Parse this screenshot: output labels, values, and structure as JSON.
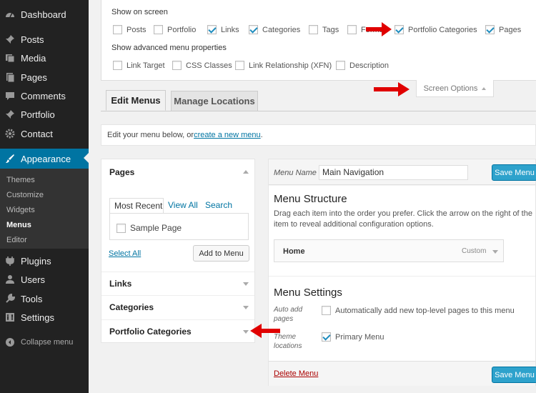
{
  "sidebar": {
    "items": [
      {
        "label": "Dashboard",
        "icon": "dashboard-icon"
      },
      {
        "label": "Posts",
        "icon": "pushpin-icon"
      },
      {
        "label": "Media",
        "icon": "media-icon"
      },
      {
        "label": "Pages",
        "icon": "page-icon"
      },
      {
        "label": "Comments",
        "icon": "comment-icon"
      },
      {
        "label": "Portfolio",
        "icon": "pushpin-icon"
      },
      {
        "label": "Contact",
        "icon": "gear-icon"
      },
      {
        "label": "Appearance",
        "icon": "brush-icon"
      }
    ],
    "appearance_submenu": [
      "Themes",
      "Customize",
      "Widgets",
      "Menus",
      "Editor"
    ],
    "lower_items": [
      {
        "label": "Plugins",
        "icon": "plug-icon"
      },
      {
        "label": "Users",
        "icon": "user-icon"
      },
      {
        "label": "Tools",
        "icon": "wrench-icon"
      },
      {
        "label": "Settings",
        "icon": "settings-icon"
      }
    ],
    "collapse_label": "Collapse menu"
  },
  "screen_options": {
    "show_on_screen_label": "Show on screen",
    "items": [
      {
        "label": "Posts",
        "checked": false
      },
      {
        "label": "Portfolio",
        "checked": false
      },
      {
        "label": "Links",
        "checked": true
      },
      {
        "label": "Categories",
        "checked": true
      },
      {
        "label": "Tags",
        "checked": false
      },
      {
        "label": "Format",
        "checked": false
      },
      {
        "label": "Portfolio Categories",
        "checked": true
      },
      {
        "label": "Pages",
        "checked": true
      }
    ],
    "advanced_label": "Show advanced menu properties",
    "advanced_items": [
      {
        "label": "Link Target",
        "checked": false
      },
      {
        "label": "CSS Classes",
        "checked": false
      },
      {
        "label": "Link Relationship (XFN)",
        "checked": false
      },
      {
        "label": "Description",
        "checked": false
      }
    ],
    "toggle_label": "Screen Options"
  },
  "tabs": {
    "edit": "Edit Menus",
    "manage": "Manage Locations"
  },
  "notice": {
    "prefix": "Edit your menu below, or ",
    "link": "create a new menu",
    "suffix": "."
  },
  "accordion": {
    "pages_title": "Pages",
    "page_tabs": [
      "Most Recent",
      "View All",
      "Search"
    ],
    "sample_page": "Sample Page",
    "select_all": "Select All",
    "add_to_menu": "Add to Menu",
    "sections": [
      "Links",
      "Categories",
      "Portfolio Categories"
    ]
  },
  "editor": {
    "menu_name_label": "Menu Name",
    "menu_name_value": "Main Navigation",
    "save_label": "Save Menu",
    "structure_title": "Menu Structure",
    "structure_desc": "Drag each item into the order you prefer. Click the arrow on the right of the item to reveal additional configuration options.",
    "menu_item_title": "Home",
    "menu_item_type": "Custom",
    "settings_title": "Menu Settings",
    "auto_add_label": "Auto add pages",
    "auto_add_option": "Automatically add new top-level pages to this menu",
    "theme_locations_label": "Theme locations",
    "primary_menu_option": "Primary Menu",
    "delete_label": "Delete Menu"
  },
  "colors": {
    "accent": "#0074a2",
    "sidebar_bg": "#222222",
    "annotation_arrow": "#e00000",
    "primary_button": "#2ea2cc"
  }
}
